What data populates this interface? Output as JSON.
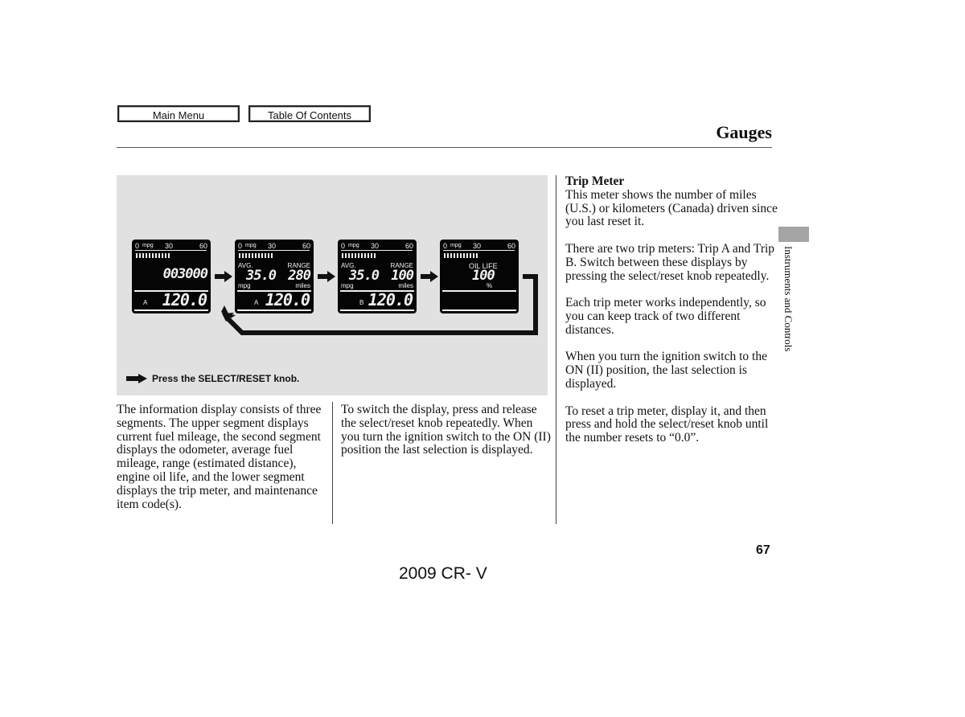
{
  "nav": {
    "main_menu": "Main Menu",
    "table_of_contents": "Table Of Contents"
  },
  "header": {
    "title": "Gauges"
  },
  "figure": {
    "caption": "Press the SELECT/RESET knob.",
    "arrow_icon": "right-arrow-icon",
    "displays": [
      {
        "scale": {
          "min": "0",
          "unit": "mpg",
          "mid": "30",
          "max": "60"
        },
        "main_value": "003000",
        "trip_label": "A",
        "trip_value": "120.0"
      },
      {
        "scale": {
          "min": "0",
          "unit": "mpg",
          "mid": "30",
          "max": "60"
        },
        "avg_label": "AVG.",
        "avg_value": "35.0",
        "avg_unit": "mpg",
        "range_label": "RANGE",
        "range_value": "280",
        "range_unit": "miles",
        "trip_label": "A",
        "trip_value": "120.0"
      },
      {
        "scale": {
          "min": "0",
          "unit": "mpg",
          "mid": "30",
          "max": "60"
        },
        "avg_label": "AVG.",
        "avg_value": "35.0",
        "avg_unit": "mpg",
        "range_label": "RANGE",
        "range_value": "100",
        "range_unit": "miles",
        "trip_label": "B",
        "trip_value": "120.0"
      },
      {
        "scale": {
          "min": "0",
          "unit": "mpg",
          "mid": "30",
          "max": "60"
        },
        "oil_label": "OIL LIFE",
        "oil_value": "100",
        "oil_unit": "%"
      }
    ]
  },
  "body": {
    "col1": [
      "The information display consists of three segments. The upper segment displays current fuel mileage, the second segment displays the odometer, average fuel mileage, range (estimated distance), engine oil life, and the lower segment displays the trip meter, and maintenance item code(s)."
    ],
    "col2": [
      "To switch the display, press and release the select/reset knob repeatedly. When you turn the ignition switch to the ON (II) position the last selection is displayed."
    ],
    "col3_heading": "Trip Meter",
    "col3": [
      "This meter shows the number of miles (U.S.) or kilometers (Canada) driven since you last reset it.",
      "There are two trip meters: Trip A and Trip B. Switch between these displays by pressing the select/reset knob repeatedly.",
      "Each trip meter works independently, so you can keep track of two different distances.",
      "When you turn the ignition switch to the ON (II) position, the last selection is displayed.",
      "To reset a trip meter, display it, and then press and hold the select/reset knob until the number resets to “0.0”."
    ]
  },
  "side_tab": {
    "label": "Instruments and Controls"
  },
  "footer": {
    "page_number": "67",
    "model": "2009  CR- V"
  }
}
